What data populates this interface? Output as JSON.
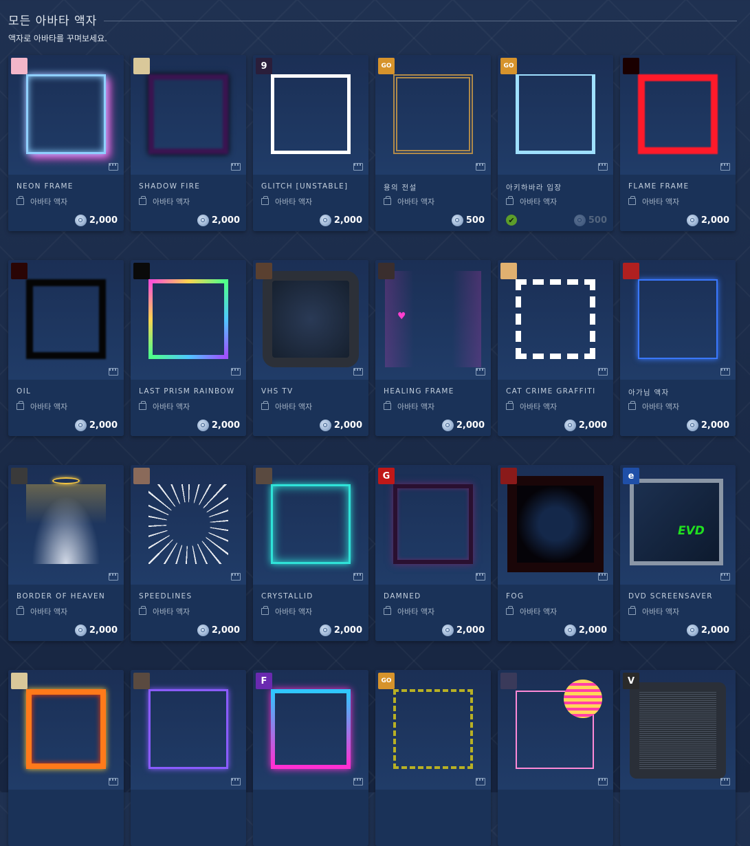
{
  "page": {
    "title": "모든 아바타 액자",
    "subtitle": "액자로 아바타를 꾸며보세요."
  },
  "items": [
    {
      "name": "NEON FRAME",
      "type": "아바타 액자",
      "price": "2,000",
      "icon": "anime-game-icon",
      "accent": "#8fd0ff",
      "frame": "neon"
    },
    {
      "name": "SHADOW FIRE",
      "type": "아바타 액자",
      "price": "2,000",
      "icon": "mask-game-icon",
      "accent": "#3a1450",
      "frame": "shadow"
    },
    {
      "name": "GLITCH [UNSTABLE]",
      "type": "아바타 액자",
      "price": "2,000",
      "icon": "nine-game-icon",
      "glyph": "9",
      "accent": "#ffffff",
      "frame": "white"
    },
    {
      "name": "용의 전설",
      "type": "아바타 액자",
      "price": "500",
      "icon": "csgo-game-icon",
      "glyph": "GO",
      "accent": "#b08a4a",
      "frame": "dragon"
    },
    {
      "name": "아키하바라 입장",
      "type": "아바타 액자",
      "price": "500",
      "icon": "csgo-game-icon",
      "glyph": "GO",
      "accent": "#9fe0ff",
      "frame": "akiba",
      "owned": true
    },
    {
      "name": "FLAME FRAME",
      "type": "아바타 액자",
      "price": "2,000",
      "icon": "red-eye-game-icon",
      "accent": "#ff1a2a",
      "frame": "red"
    },
    {
      "name": "OIL",
      "type": "아바타 액자",
      "price": "2,000",
      "icon": "red-fire-game-icon",
      "accent": "#050505",
      "frame": "oil"
    },
    {
      "name": "LAST PRISM RAINBOW",
      "type": "아바타 액자",
      "price": "2,000",
      "icon": "tree-game-icon",
      "accent": "#ff4fd8",
      "frame": "rainbow"
    },
    {
      "name": "VHS TV",
      "type": "아바타 액자",
      "price": "2,000",
      "icon": "wood-game-icon",
      "accent": "#3a4250",
      "frame": "vhs"
    },
    {
      "name": "HEALING FRAME",
      "type": "아바타 액자",
      "price": "2,000",
      "icon": "pixel-game-icon",
      "accent": "#ff3fcf",
      "frame": "healing"
    },
    {
      "name": "CAT CRIME GRAFFITI",
      "type": "아바타 액자",
      "price": "2,000",
      "icon": "character-game-icon",
      "accent": "#ffffff",
      "frame": "graffiti"
    },
    {
      "name": "아가님 액자",
      "type": "아바타 액자",
      "price": "2,000",
      "icon": "dota-game-icon",
      "accent": "#3a78ff",
      "frame": "blue"
    },
    {
      "name": "BORDER OF HEAVEN",
      "type": "아바타 액자",
      "price": "2,000",
      "icon": "hood-game-icon",
      "accent": "#f4c542",
      "frame": "heaven"
    },
    {
      "name": "SPEEDLINES",
      "type": "아바타 액자",
      "price": "2,000",
      "icon": "comic-game-icon",
      "accent": "#ffffff",
      "frame": "speed"
    },
    {
      "name": "CRYSTALLID",
      "type": "아바타 액자",
      "price": "2,000",
      "icon": "triangle-game-icon",
      "accent": "#2fe3d8",
      "frame": "crystal"
    },
    {
      "name": "DAMNED",
      "type": "아바타 액자",
      "price": "2,000",
      "icon": "red-g-game-icon",
      "glyph": "G",
      "accent": "#6a2a6a",
      "frame": "damned"
    },
    {
      "name": "FOG",
      "type": "아바타 액자",
      "price": "2,000",
      "icon": "red-character-game-icon",
      "accent": "#2a0c10",
      "frame": "fog"
    },
    {
      "name": "DVD SCREENSAVER",
      "type": "아바타 액자",
      "price": "2,000",
      "icon": "e-game-icon",
      "glyph": "e",
      "accent": "#8a96a6",
      "frame": "dvd",
      "extra": "EVD"
    },
    {
      "name": "",
      "type": "",
      "price": "",
      "icon": "mask-game-icon",
      "accent": "#ff7a1a",
      "frame": "fire"
    },
    {
      "name": "",
      "type": "",
      "price": "",
      "icon": "triangle-game-icon",
      "accent": "#8a5cff",
      "frame": "purple"
    },
    {
      "name": "",
      "type": "",
      "price": "",
      "icon": "f-game-icon",
      "glyph": "F",
      "accent": "#ff2fd1",
      "frame": "pinkneon"
    },
    {
      "name": "",
      "type": "",
      "price": "",
      "icon": "csgo-game-icon",
      "glyph": "GO",
      "accent": "#b8b024",
      "frame": "wolf"
    },
    {
      "name": "",
      "type": "",
      "price": "",
      "icon": "floppy-game-icon",
      "accent": "#ff8ad8",
      "frame": "sunset"
    },
    {
      "name": "",
      "type": "",
      "price": "",
      "icon": "v-game-icon",
      "glyph": "V",
      "accent": "#2a2f38",
      "frame": "tv"
    }
  ]
}
